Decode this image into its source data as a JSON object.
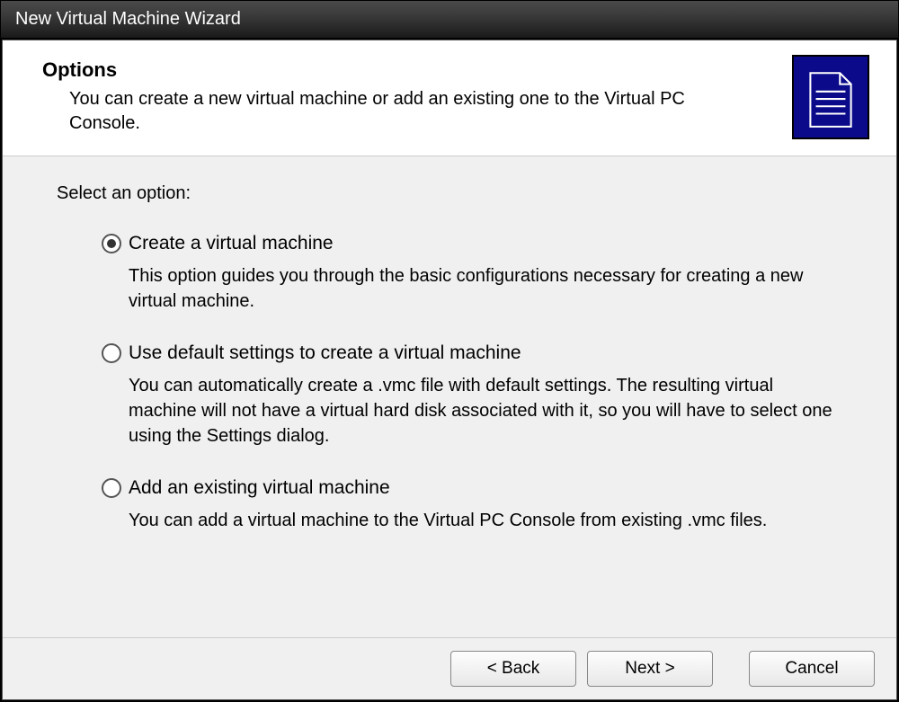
{
  "window": {
    "title": "New Virtual Machine Wizard"
  },
  "header": {
    "title": "Options",
    "description": "You can create a new virtual machine or add an existing one to the Virtual PC Console."
  },
  "content": {
    "prompt": "Select an option:",
    "options": [
      {
        "label": "Create a virtual machine",
        "description": "This option guides you through the basic configurations necessary for creating a new virtual machine.",
        "selected": true
      },
      {
        "label": "Use default settings to create a virtual machine",
        "description": "You can automatically create a .vmc file with default settings. The resulting virtual machine will not have a virtual hard disk associated with it, so you will have to select one using the Settings dialog.",
        "selected": false
      },
      {
        "label": "Add an existing virtual machine",
        "description": "You can add a virtual machine to the Virtual PC Console from existing .vmc files.",
        "selected": false
      }
    ]
  },
  "buttons": {
    "back": "< Back",
    "next": "Next >",
    "cancel": "Cancel"
  }
}
